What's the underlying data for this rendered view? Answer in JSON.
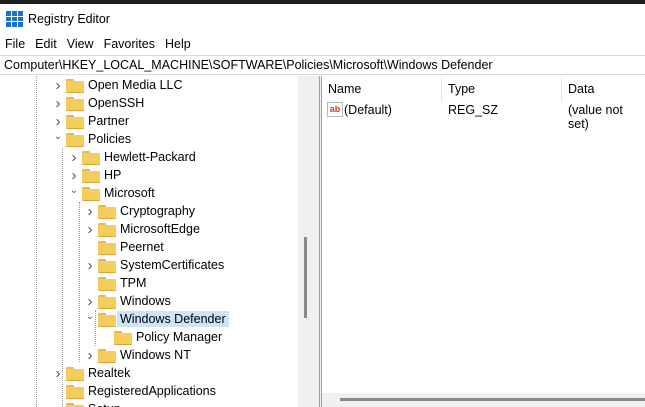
{
  "window": {
    "title": "Registry Editor"
  },
  "menu": [
    "File",
    "Edit",
    "View",
    "Favorites",
    "Help"
  ],
  "address": "Computer\\HKEY_LOCAL_MACHINE\\SOFTWARE\\Policies\\Microsoft\\Windows Defender",
  "tree": [
    {
      "label": "Open Media LLC",
      "level": 0,
      "state": "collapsed"
    },
    {
      "label": "OpenSSH",
      "level": 0,
      "state": "collapsed"
    },
    {
      "label": "Partner",
      "level": 0,
      "state": "collapsed"
    },
    {
      "label": "Policies",
      "level": 0,
      "state": "expanded"
    },
    {
      "label": "Hewlett-Packard",
      "level": 1,
      "state": "collapsed"
    },
    {
      "label": "HP",
      "level": 1,
      "state": "collapsed"
    },
    {
      "label": "Microsoft",
      "level": 1,
      "state": "expanded"
    },
    {
      "label": "Cryptography",
      "level": 2,
      "state": "collapsed"
    },
    {
      "label": "MicrosoftEdge",
      "level": 2,
      "state": "collapsed"
    },
    {
      "label": "Peernet",
      "level": 2,
      "state": "leaf"
    },
    {
      "label": "SystemCertificates",
      "level": 2,
      "state": "collapsed"
    },
    {
      "label": "TPM",
      "level": 2,
      "state": "leaf"
    },
    {
      "label": "Windows",
      "level": 2,
      "state": "collapsed"
    },
    {
      "label": "Windows Defender",
      "level": 2,
      "state": "expanded",
      "selected": true
    },
    {
      "label": "Policy Manager",
      "level": 3,
      "state": "leaf"
    },
    {
      "label": "Windows NT",
      "level": 2,
      "state": "collapsed"
    },
    {
      "label": "Realtek",
      "level": 0,
      "state": "collapsed"
    },
    {
      "label": "RegisteredApplications",
      "level": 0,
      "state": "leaf"
    },
    {
      "label": "Setup",
      "level": 0,
      "state": "collapsed"
    }
  ],
  "columns": {
    "name": "Name",
    "type": "Type",
    "data": "Data"
  },
  "values": [
    {
      "name": "(Default)",
      "type": "REG_SZ",
      "data": "(value not set)",
      "icon": "ab"
    }
  ],
  "colors": {
    "selection": "#cce4f7",
    "folder": "#f5cd5c",
    "accent": "#1e6fc8"
  }
}
